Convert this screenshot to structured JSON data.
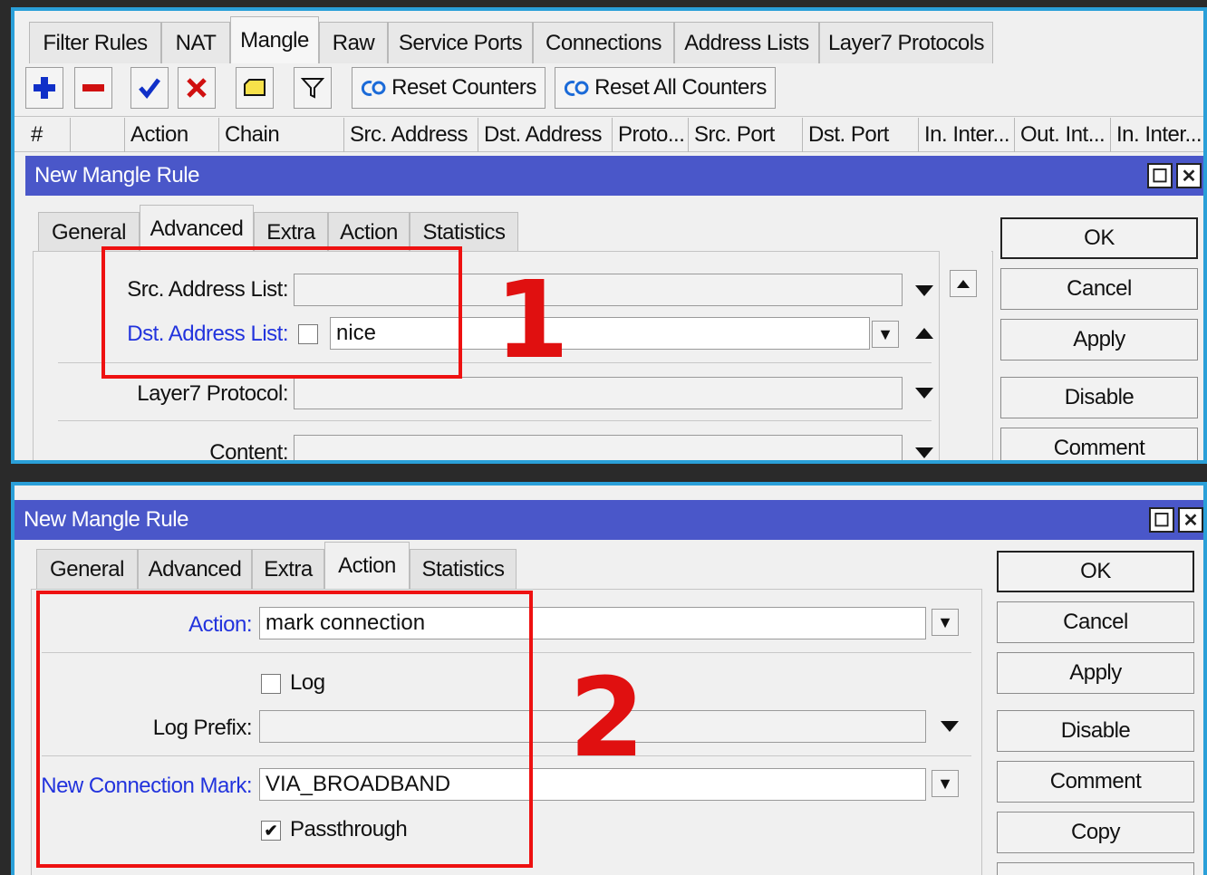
{
  "top": {
    "tabs": [
      "Filter Rules",
      "NAT",
      "Mangle",
      "Raw",
      "Service Ports",
      "Connections",
      "Address Lists",
      "Layer7 Protocols"
    ],
    "active_tab": "Mangle",
    "toolbar": {
      "reset_counters": "Reset Counters",
      "reset_all_counters": "Reset All Counters"
    },
    "columns": [
      "#",
      "",
      "Action",
      "Chain",
      "Src. Address",
      "Dst. Address",
      "Proto...",
      "Src. Port",
      "Dst. Port",
      "In. Inter...",
      "Out. Int...",
      "In. Inter..."
    ],
    "dialog": {
      "title": "New Mangle Rule",
      "tabs": [
        "General",
        "Advanced",
        "Extra",
        "Action",
        "Statistics"
      ],
      "active_tab": "Advanced",
      "fields": {
        "src_address_list_label": "Src. Address List:",
        "src_address_list_value": "",
        "dst_address_list_label": "Dst. Address List:",
        "dst_address_list_value": "nice",
        "layer7_label": "Layer7 Protocol:",
        "layer7_value": "",
        "content_label": "Content:",
        "content_value": ""
      },
      "buttons": [
        "OK",
        "Cancel",
        "Apply",
        "Disable",
        "Comment"
      ]
    },
    "annotation": "1"
  },
  "bottom": {
    "dialog": {
      "title": "New Mangle Rule",
      "tabs": [
        "General",
        "Advanced",
        "Extra",
        "Action",
        "Statistics"
      ],
      "active_tab": "Action",
      "fields": {
        "action_label": "Action:",
        "action_value": "mark connection",
        "log_label": "Log",
        "log_checked": false,
        "log_prefix_label": "Log Prefix:",
        "log_prefix_value": "",
        "new_conn_mark_label": "New Connection Mark:",
        "new_conn_mark_value": "VIA_BROADBAND",
        "passthrough_label": "Passthrough",
        "passthrough_checked": true
      },
      "buttons": [
        "OK",
        "Cancel",
        "Apply",
        "Disable",
        "Comment",
        "Copy"
      ]
    },
    "annotation": "2"
  },
  "colors": {
    "panel_border": "#2a9fd8",
    "titlebar": "#4a57c9",
    "highlight_box": "#e11111",
    "blue_label": "#2233dd"
  }
}
